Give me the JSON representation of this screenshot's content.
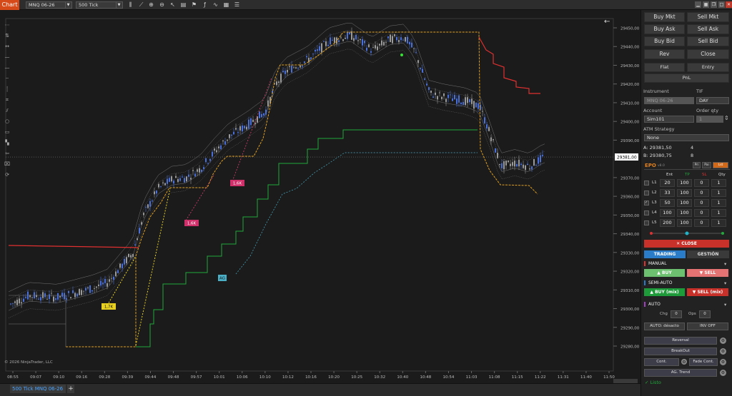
{
  "toolbar": {
    "chart_label": "Chart",
    "instrument": "MNQ 06-26",
    "interval": "500 Tick"
  },
  "chart": {
    "price_labels": [
      "29450,00",
      "29440,00",
      "29430,00",
      "29420,00",
      "29410,00",
      "29400,00",
      "29390,00",
      "29381,00",
      "29370,00",
      "29360,00",
      "29350,00",
      "29340,00",
      "29330,00",
      "29320,00",
      "29310,00",
      "29300,00",
      "29290,00",
      "29280,00"
    ],
    "current_price": "29381,00",
    "time_labels": [
      "08:55",
      "09:07",
      "09:10",
      "09:16",
      "09:28",
      "09:39",
      "09:44",
      "09:48",
      "09:57",
      "10:01",
      "10:06",
      "10:10",
      "10:12",
      "10:16",
      "10:20",
      "10:25",
      "10:32",
      "10:40",
      "10:48",
      "10:54",
      "11:03",
      "11:08",
      "11:15",
      "11:22",
      "11:31",
      "11:40",
      "11:50"
    ],
    "copyright": "© 2026 NinjaTrader, LLC",
    "markers": {
      "m1": "1,7K",
      "m2": "1,6K",
      "m3": "1,6K",
      "ag": "AG"
    },
    "colors": {
      "up": "#4a6fd6",
      "down": "#9a9a9a",
      "orange": "#e0a020",
      "red": "#e03030",
      "green": "#1faa3a",
      "yellow": "#e8d020",
      "cyan": "#4ab0c8"
    }
  },
  "tabs": {
    "instrument_tab": "500 Tick MNQ 06-26",
    "add": "+"
  },
  "panel": {
    "buy_mkt": "Buy Mkt",
    "sell_mkt": "Sell Mkt",
    "buy_ask": "Buy Ask",
    "sell_ask": "Sell Ask",
    "buy_bid": "Buy Bid",
    "sell_bid": "Sell Bid",
    "rev": "Rev",
    "close": "Close",
    "flat": "Flat",
    "entry": "Entry",
    "pnl": "PnL",
    "instrument_label": "Instrument",
    "instrument_value": "MNQ 06-26",
    "tif_label": "TIF",
    "tif_value": "DAY",
    "account_label": "Account",
    "account_value": "Sim101",
    "qty_label": "Order qty",
    "qty_value": "1",
    "atm_label": "ATM Strategy",
    "atm_value": "None",
    "ask_line": "A: 29381,50",
    "ask_size": "4",
    "bid_line": "B: 29380,75",
    "bid_size": "8",
    "epo_title": "EPO",
    "epo_ver": "v8.0",
    "epo_tabs": [
      "Pri",
      "Pai",
      "Lst"
    ],
    "epo_headers": [
      "Ent",
      "TP",
      "SL",
      "Qty"
    ],
    "epo_rows": [
      {
        "label": "L1",
        "ent": "20",
        "tp": "100",
        "sl": "0",
        "qty": "1"
      },
      {
        "label": "L2",
        "ent": "33",
        "tp": "100",
        "sl": "0",
        "qty": "1"
      },
      {
        "label": "L3",
        "ent": "50",
        "tp": "100",
        "sl": "0",
        "qty": "1"
      },
      {
        "label": "L4",
        "ent": "100",
        "tp": "100",
        "sl": "0",
        "qty": "1"
      },
      {
        "label": "L5",
        "ent": "200",
        "tp": "100",
        "sl": "0",
        "qty": "1"
      }
    ],
    "close_btn": "✕ CLOSE",
    "trading_tab": "TRADING",
    "gestion_tab": "GESTIÓN",
    "manual": "MANUAL",
    "buy": "▲ BUY",
    "sell": "▼ SELL",
    "semi_auto": "SEMI-AUTO",
    "buy_mix": "▲ BUY (mix)",
    "sell_mix": "▼ SELL (mix)",
    "auto": "AUTO",
    "chg_label": "Chg",
    "chg_value": "0",
    "ops_label": "Ops",
    "ops_value": "0",
    "auto_btn": "AUTO: désacto",
    "inv_btn": "INV OFF",
    "reversal": "Reversal",
    "breakout": "BreakOut",
    "cont": "Cont.",
    "fade_cont": "Fade Cont.",
    "ag_trend": "AG. Trend",
    "status": "✓ Listo"
  }
}
